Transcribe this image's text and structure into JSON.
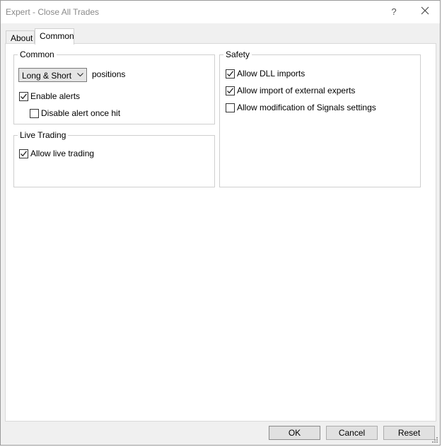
{
  "window": {
    "title": "Expert - Close All Trades",
    "help_glyph": "?",
    "close_icon": "close-icon"
  },
  "tabs": [
    {
      "label": "About",
      "active": false
    },
    {
      "label": "Common",
      "active": true
    }
  ],
  "common_group": {
    "title": "Common",
    "positions_select": {
      "value": "Long & Short"
    },
    "positions_label": "positions",
    "enable_alerts": {
      "label": "Enable alerts",
      "checked": true
    },
    "disable_alert_once_hit": {
      "label": "Disable alert once hit",
      "checked": false
    }
  },
  "live_trading_group": {
    "title": "Live Trading",
    "allow_live_trading": {
      "label": "Allow live trading",
      "checked": true
    }
  },
  "safety_group": {
    "title": "Safety",
    "allow_dll_imports": {
      "label": "Allow DLL imports",
      "checked": true
    },
    "allow_import_external_experts": {
      "label": "Allow import of external experts",
      "checked": true
    },
    "allow_modification_signals": {
      "label": "Allow modification of Signals settings",
      "checked": false
    }
  },
  "buttons": {
    "ok": "OK",
    "cancel": "Cancel",
    "reset": "Reset"
  }
}
